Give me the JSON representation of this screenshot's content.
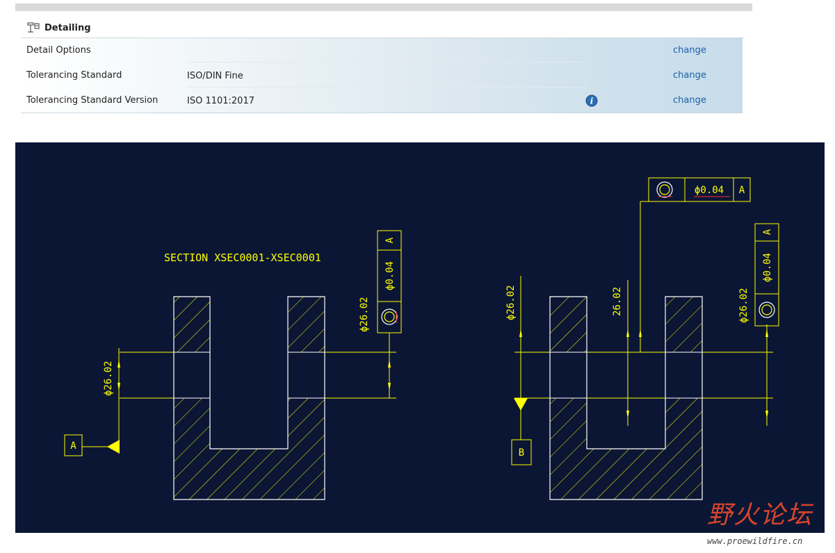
{
  "section": {
    "title": "Detailing",
    "icon": "detailing-icon"
  },
  "rows": [
    {
      "label": "Detail Options",
      "value": "",
      "action": "change"
    },
    {
      "label": "Tolerancing Standard",
      "value": "ISO/DIN Fine",
      "action": "change"
    },
    {
      "label": "Tolerancing Standard Version",
      "value": "ISO 1101:2017",
      "action": "change",
      "info_icon": "info-icon"
    }
  ],
  "drawing": {
    "section_label": "SECTION XSEC0001-XSEC0001",
    "dimension_text": "ϕ26.02",
    "dimension_text_plain": "26.02",
    "tolerance": "ϕ0.04",
    "datum_a": "A",
    "datum_b": "B",
    "colors": {
      "background": "#0b1635",
      "line": "#ffff00",
      "outline": "#ffffff",
      "accent": "#ff3030"
    }
  },
  "watermark": {
    "chinese": "野火论坛",
    "url": "www.proewildfire.cn"
  }
}
